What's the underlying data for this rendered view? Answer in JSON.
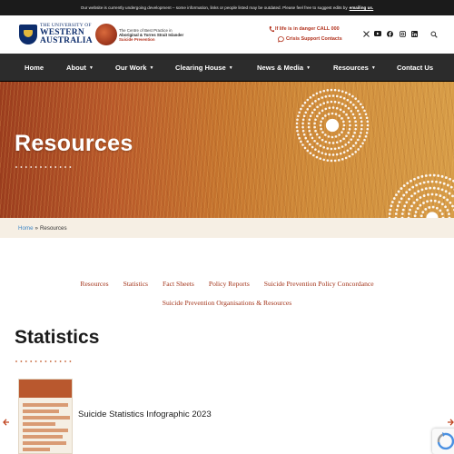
{
  "notice": {
    "text": "Our website is currently undergoing development – some information, links or people listed may be outdated. Please feel free to suggest edits by",
    "link": "emailing us."
  },
  "header": {
    "uwa_logo": {
      "line1": "THE UNIVERSITY OF",
      "line2": "WESTERN",
      "line3": "AUSTRALIA"
    },
    "centre_logo": {
      "line1": "The Centre of Best Practice in",
      "line2": "Aboriginal & Torres Strait Islander",
      "line3": "Suicide Prevention"
    },
    "danger_text": "If life is in danger CALL 000",
    "crisis_text": "Crisis Support Contacts",
    "social_icons": [
      "x-icon",
      "youtube-icon",
      "facebook-icon",
      "instagram-icon",
      "linkedin-icon"
    ],
    "search_icon": "search-icon"
  },
  "nav": {
    "items": [
      {
        "label": "Home",
        "dropdown": false
      },
      {
        "label": "About",
        "dropdown": true
      },
      {
        "label": "Our Work",
        "dropdown": true
      },
      {
        "label": "Clearing House",
        "dropdown": true
      },
      {
        "label": "News & Media",
        "dropdown": true
      },
      {
        "label": "Resources",
        "dropdown": true
      },
      {
        "label": "Contact Us",
        "dropdown": false
      }
    ]
  },
  "hero": {
    "title": "Resources"
  },
  "breadcrumb": {
    "home": "Home",
    "separator": "»",
    "current": "Resources"
  },
  "subnav": {
    "row1": [
      "Resources",
      "Statistics",
      "Fact Sheets",
      "Policy Reports",
      "Suicide Prevention Policy Concordance"
    ],
    "row2": [
      "Suicide Prevention Organisations & Resources"
    ]
  },
  "section": {
    "title": "Statistics"
  },
  "carousel": {
    "item_caption": "Suicide Statistics Infographic 2023",
    "prev_icon": "arrow-left-icon",
    "next_icon": "arrow-right-icon"
  },
  "colors": {
    "accent_red": "#b2331e",
    "nav_bg": "#2c2c2c",
    "link_blue": "#3d86c6",
    "subnav_link": "#a3341a",
    "dot_orange": "#c25a2b"
  }
}
